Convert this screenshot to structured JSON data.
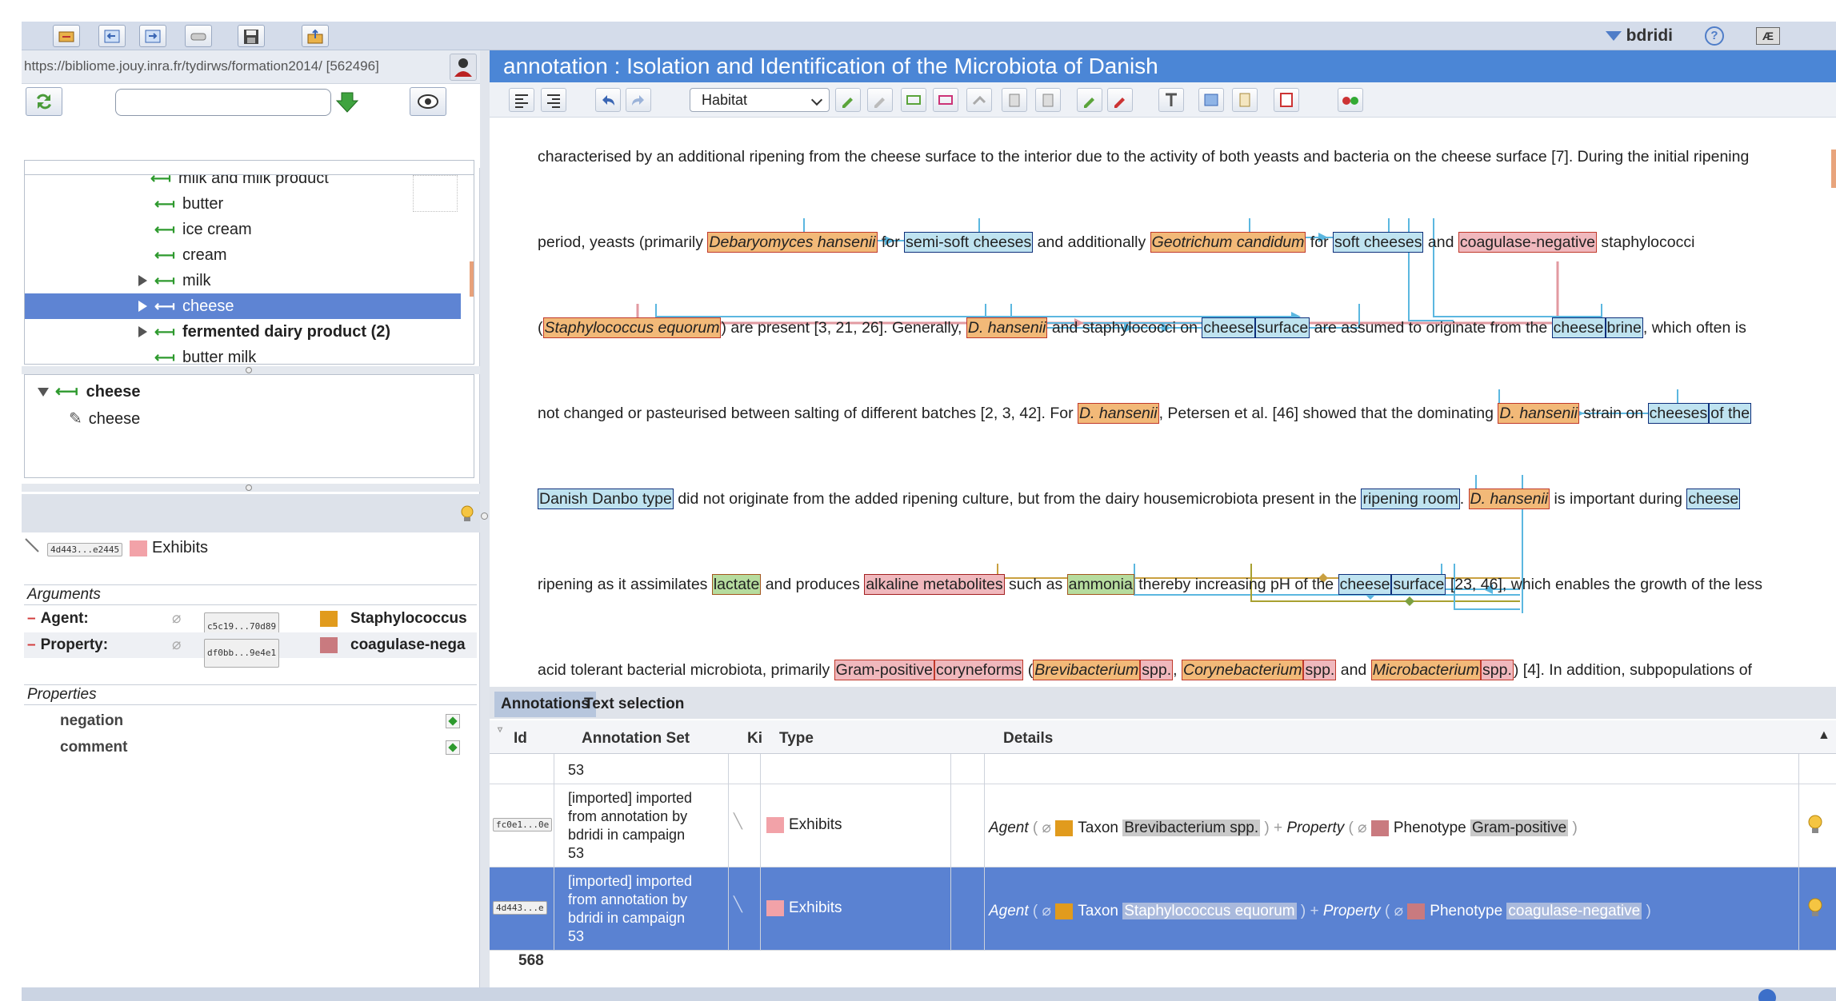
{
  "user": {
    "name": "bdridi",
    "help_glyph": "?",
    "lang_glyph": "Æ"
  },
  "left": {
    "url": "https://bibliome.jouy.inra.fr/tydirws/formation2014/ [562496]",
    "search_placeholder": "",
    "tree": [
      {
        "label": "milk and milk product",
        "indent": 2,
        "arrow": false,
        "bold": false,
        "selected": false
      },
      {
        "label": "butter",
        "indent": 3,
        "arrow": false,
        "bold": false,
        "selected": false
      },
      {
        "label": "ice cream",
        "indent": 3,
        "arrow": false,
        "bold": false,
        "selected": false
      },
      {
        "label": "cream",
        "indent": 3,
        "arrow": false,
        "bold": false,
        "selected": false
      },
      {
        "label": "milk",
        "indent": 3,
        "arrow": true,
        "bold": false,
        "selected": false
      },
      {
        "label": "cheese",
        "indent": 3,
        "arrow": true,
        "bold": false,
        "selected": true
      },
      {
        "label": "fermented dairy product (2)",
        "indent": 3,
        "arrow": true,
        "bold": true,
        "selected": false
      },
      {
        "label": "butter milk",
        "indent": 3,
        "arrow": false,
        "bold": false,
        "selected": false
      }
    ],
    "tree2": {
      "parent": "cheese",
      "child": "cheese"
    },
    "annotation": {
      "id": "4d443...e2445",
      "type": "Exhibits",
      "type_color": "#f2a2a8"
    },
    "arguments_title": "Arguments",
    "arguments": [
      {
        "role": "Agent",
        "id": "c5c19...70d89",
        "color": "#e19b1d",
        "value": "Staphylococcus"
      },
      {
        "role": "Property",
        "id": "df0bb...9e4e1",
        "color": "#c97a7f",
        "value": "coagulase-nega"
      }
    ],
    "properties_title": "Properties",
    "properties": [
      "negation",
      "comment"
    ]
  },
  "doc": {
    "title": "annotation : Isolation and Identification of the Microbiota of Danish",
    "type_select": "Habitat",
    "lines": [
      [
        [
          "t",
          "characterised by an additional ripening from the cheese surface to the interior due to the activity of both yeasts and bacteria on the cheese surface [7]. During the initial ripening"
        ]
      ],
      [
        [
          "t",
          "period, yeasts (primarily "
        ],
        [
          "o",
          "Debaryomyces hansenii"
        ],
        [
          "t",
          " for "
        ],
        [
          "b",
          "semi-soft cheeses"
        ],
        [
          "t",
          " and additionally "
        ],
        [
          "o",
          "Geotrichum candidum"
        ],
        [
          "t",
          " for "
        ],
        [
          "b",
          "soft cheeses"
        ],
        [
          "t",
          " and "
        ],
        [
          "p",
          "coagulase-negative"
        ],
        [
          "t",
          " staphylococci"
        ]
      ],
      [
        [
          "t",
          "("
        ],
        [
          "o",
          "Staphylococcus equorum"
        ],
        [
          "t",
          ") are present [3, 21, 26]. Generally, "
        ],
        [
          "o",
          "D. hansenii"
        ],
        [
          "t",
          " and staphylococci on "
        ],
        [
          "b",
          "cheese"
        ],
        [
          "b",
          "surface"
        ],
        [
          "t",
          " are assumed to originate from the "
        ],
        [
          "b",
          "cheese"
        ],
        [
          "b",
          "brine"
        ],
        [
          "t",
          ", which often is"
        ]
      ],
      [
        [
          "t",
          "not changed or pasteurised between salting of different batches [2, 3, 42]. For "
        ],
        [
          "o",
          "D. hansenii"
        ],
        [
          "t",
          ", Petersen et al. [46] showed that the dominating "
        ],
        [
          "o",
          "D. hansenii"
        ],
        [
          "t",
          " strain on "
        ],
        [
          "b",
          "cheeses"
        ],
        [
          "b",
          "of the"
        ]
      ],
      [
        [
          "b",
          "Danish Danbo type"
        ],
        [
          "t",
          " did not originate from the added ripening culture, but from the dairy housemicrobiota present in the "
        ],
        [
          "b",
          "ripening room"
        ],
        [
          "t",
          ". "
        ],
        [
          "o",
          "D. hansenii"
        ],
        [
          "t",
          " is important during "
        ],
        [
          "b",
          "cheese"
        ]
      ],
      [
        [
          "t",
          "ripening as it assimilates "
        ],
        [
          "g",
          "lactate"
        ],
        [
          "t",
          " and produces "
        ],
        [
          "s",
          "alkaline metabolites"
        ],
        [
          "t",
          " such as "
        ],
        [
          "g",
          "ammonia"
        ],
        [
          "t",
          " thereby increasing pH of the "
        ],
        [
          "b",
          "cheese"
        ],
        [
          "b",
          "surface"
        ],
        [
          "t",
          " [23, 46], which enables the growth of the less"
        ]
      ],
      [
        [
          "t",
          "acid tolerant bacterial microbiota, primarily "
        ],
        [
          "p",
          "Gram-positive"
        ],
        [
          "p",
          "coryneforms"
        ],
        [
          "t",
          " ("
        ],
        [
          "o",
          "Brevibacterium"
        ],
        [
          "p",
          "spp."
        ],
        [
          "t",
          ", "
        ],
        [
          "o",
          "Corynebacterium"
        ],
        [
          "p",
          "spp."
        ],
        [
          "t",
          " and "
        ],
        [
          "o",
          "Microbacterium"
        ],
        [
          "p",
          "spp."
        ],
        [
          "t",
          ") [4]. In addition, subpopulations of"
        ]
      ]
    ]
  },
  "tabs": [
    "Annotations",
    "Text selection"
  ],
  "table": {
    "headers": {
      "id": "Id",
      "set": "Annotation Set",
      "kind": "Ki",
      "type": "Type",
      "details": "Details"
    },
    "partial_row": {
      "set_tail": "53"
    },
    "rows": [
      {
        "id": "fc0e1...0e",
        "set": [
          "[imported] imported",
          "from annotation by",
          "bdridi in campaign",
          "53"
        ],
        "type": "Exhibits",
        "agent_label": "Agent",
        "agent_kind": "Taxon",
        "agent_value": "Brevibacterium spp.",
        "property_label": "Property",
        "property_kind": "Phenotype",
        "property_value": "Gram-positive",
        "selected": false
      },
      {
        "id": "4d443...e",
        "set": [
          "[imported] imported",
          "from annotation by",
          "bdridi in campaign",
          "53"
        ],
        "type": "Exhibits",
        "agent_label": "Agent",
        "agent_kind": "Taxon",
        "agent_value": "Staphylococcus equorum",
        "property_label": "Property",
        "property_kind": "Phenotype",
        "property_value": "coagulase-negative",
        "selected": true
      }
    ],
    "count": "568"
  },
  "colors": {
    "accent": "#4b86d6",
    "selection": "#5a82d2",
    "taxon": "#e19b1d",
    "phenotype": "#c97a7f",
    "exhibits": "#f2a2a8"
  }
}
